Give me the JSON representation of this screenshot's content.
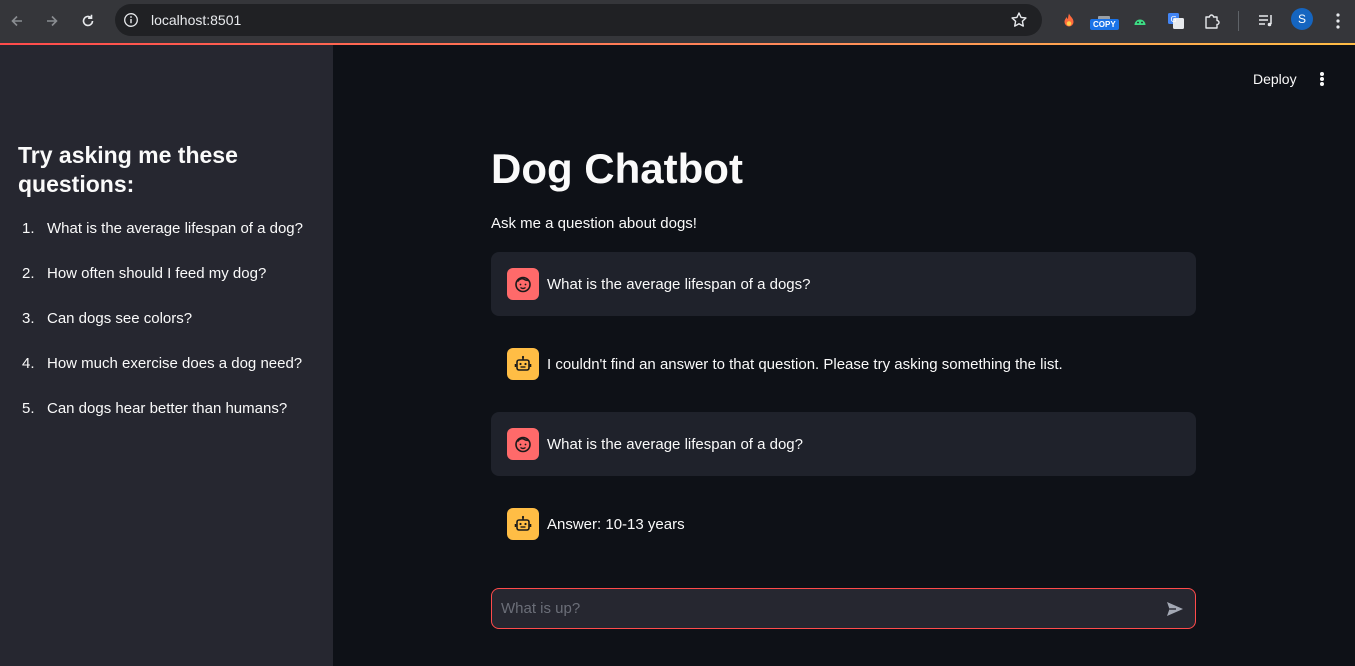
{
  "browser": {
    "url": "localhost:8501",
    "profile_initial": "S",
    "copy_badge": "COPY"
  },
  "sidebar": {
    "title": "Try asking me these questions:",
    "questions": [
      {
        "num": "1.",
        "text": "What is the average lifespan of a dog?"
      },
      {
        "num": "2.",
        "text": "How often should I feed my dog?"
      },
      {
        "num": "3.",
        "text": "Can dogs see colors?"
      },
      {
        "num": "4.",
        "text": "How much exercise does a dog need?"
      },
      {
        "num": "5.",
        "text": "Can dogs hear better than humans?"
      }
    ]
  },
  "header": {
    "deploy_label": "Deploy"
  },
  "main": {
    "title": "Dog Chatbot",
    "subtitle": "Ask me a question about dogs!",
    "messages": [
      {
        "role": "user",
        "icon": "user-face-icon",
        "text": "What is the average lifespan of a dogs?"
      },
      {
        "role": "assistant",
        "icon": "robot-icon",
        "text": "I couldn't find an answer to that question. Please try asking something the list."
      },
      {
        "role": "user",
        "icon": "user-face-icon",
        "text": "What is the average lifespan of a dog?"
      },
      {
        "role": "assistant",
        "icon": "robot-icon",
        "text": "Answer: 10-13 years"
      }
    ],
    "chat_input": {
      "placeholder": "What is up?",
      "value": ""
    }
  },
  "colors": {
    "accent": "#ff4b4b",
    "user_avatar": "#ff6a6a",
    "bot_avatar": "#ffbd45",
    "sidebar_bg": "#262730",
    "main_bg": "#0e1117"
  }
}
